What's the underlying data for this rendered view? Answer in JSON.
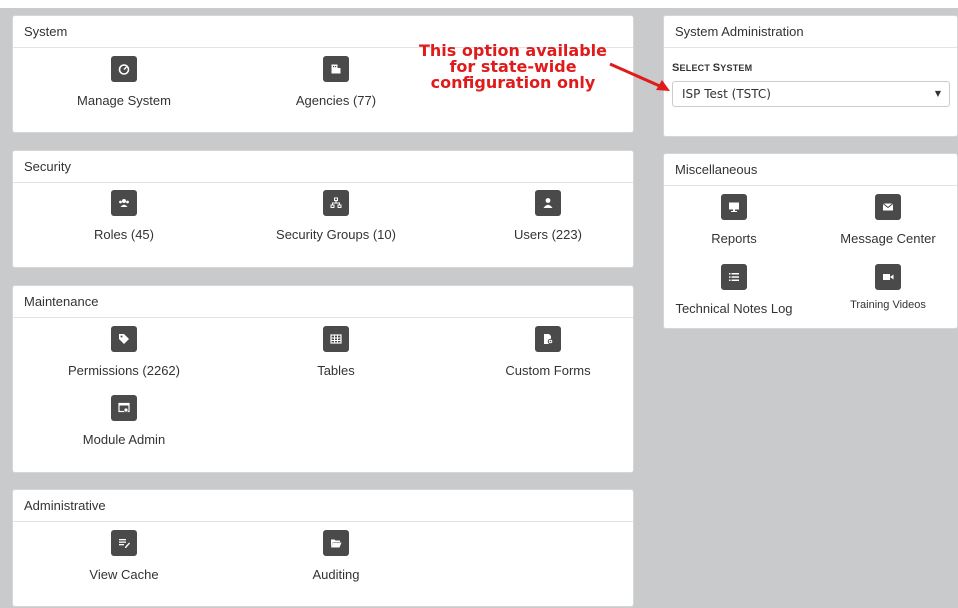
{
  "panels": {
    "system": {
      "title": "System",
      "tiles": [
        "Manage System",
        "Agencies (77)"
      ]
    },
    "security": {
      "title": "Security",
      "tiles": [
        "Roles (45)",
        "Security Groups (10)",
        "Users (223)"
      ]
    },
    "maintenance": {
      "title": "Maintenance",
      "tiles": [
        "Permissions (2262)",
        "Tables",
        "Custom Forms",
        "Module Admin"
      ]
    },
    "administrative": {
      "title": "Administrative",
      "tiles": [
        "View Cache",
        "Auditing"
      ]
    },
    "system_admin": {
      "title": "System Administration",
      "select_label_first": "S",
      "select_label_rest": "ELECT ",
      "select_label_first2": "S",
      "select_label_rest2": "YSTEM",
      "selected_value": "ISP Test (TSTC)",
      "caret": "▼"
    },
    "misc": {
      "title": "Miscellaneous",
      "tiles": [
        "Reports",
        "Message Center",
        "Technical Notes Log",
        "Training Videos"
      ]
    }
  },
  "annotation": {
    "line1": "This option available",
    "line2": "for state-wide",
    "line3": "configuration only"
  },
  "colors": {
    "icon_bg": "#4a4a4a",
    "annotation": "#e01b1b",
    "page_bg": "#c9cacb"
  },
  "icons": [
    "tachometer-icon",
    "building-icon",
    "users-icon",
    "sitemap-icon",
    "user-icon",
    "tags-icon",
    "table-icon",
    "file-gear-icon",
    "window-gear-icon",
    "edit-icon",
    "folder-open-icon",
    "desktop-icon",
    "envelope-icon",
    "list-icon",
    "video-icon"
  ]
}
